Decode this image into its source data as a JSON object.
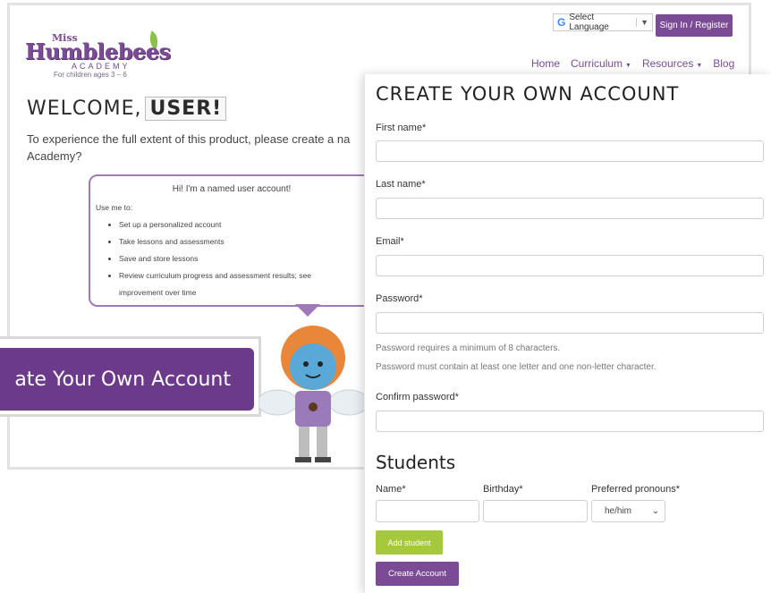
{
  "logo": {
    "miss": "Miss",
    "main": "Humblebees",
    "academy": "ACADEMY",
    "age": "For children ages 3 – 6"
  },
  "header": {
    "language": "Select Language",
    "language_glyph": "G",
    "language_arrow": "▼",
    "signin": "Sign In / Register"
  },
  "nav": {
    "items": [
      {
        "label": "Home",
        "chev": ""
      },
      {
        "label": "Curriculum",
        "chev": "▼"
      },
      {
        "label": "Resources",
        "chev": "▼"
      },
      {
        "label": "Blog",
        "chev": ""
      }
    ]
  },
  "welcome": {
    "prefix": "WELCOME,",
    "user": "USER!"
  },
  "intro": {
    "text": "To experience the full extent of this product, please create a na Academy?"
  },
  "bubble": {
    "title": "Hi! I'm a named user account!",
    "use_me": "Use me to:",
    "items": [
      "Set up a personalized account",
      "Take lessons and assessments",
      "Save and store lessons",
      "Review curriculum progress and assessment results; see improvement over time"
    ]
  },
  "big_button": {
    "label": "ate Your Own Account"
  },
  "form": {
    "title": "CREATE YOUR OWN ACCOUNT",
    "first_name": "First name*",
    "last_name": "Last name*",
    "email": "Email*",
    "password": "Password*",
    "hint1": "Password requires a minimum of 8 characters.",
    "hint2": "Password must contain at least one letter and one non-letter character.",
    "confirm": "Confirm password*",
    "students": "Students",
    "student_name": "Name*",
    "birthday": "Birthday*",
    "pronouns": "Preferred pronouns*",
    "pronoun_value": "he/him",
    "add_student": "Add student",
    "create_account": "Create Account"
  },
  "colors": {
    "brand_purple": "#7b4b96",
    "accent_green": "#a6c83b"
  }
}
